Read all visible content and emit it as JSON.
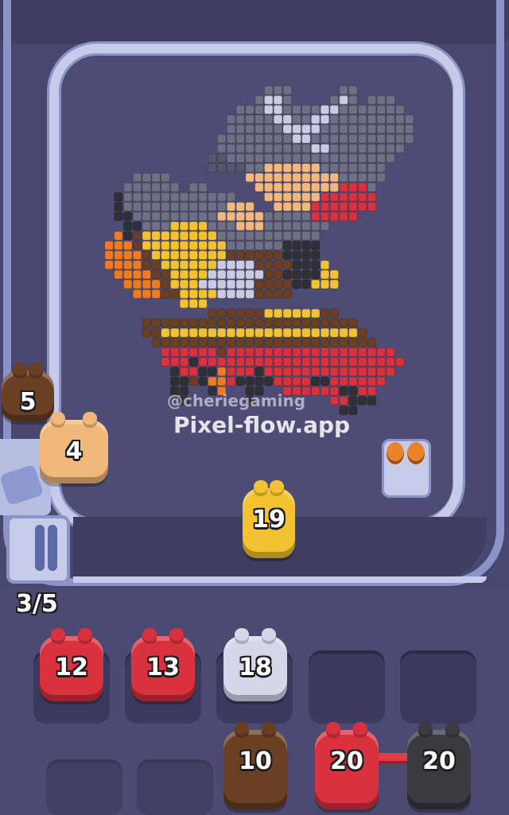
{
  "watermark": {
    "handle": "@cheriegaming",
    "site": "Pixel-flow.app"
  },
  "queue_counter": "3/5",
  "colors": {
    "red": "#d9313e",
    "yellow": "#f2c230",
    "white": "#d4d7ea",
    "brown": "#6a3f24",
    "tan": "#f0b87a",
    "black": "#3a3a3f",
    "gray": "#6b6f84",
    "orange": "#f07a1e"
  },
  "track_shooters": [
    {
      "number": "5",
      "color": "brown"
    },
    {
      "number": "4",
      "color": "tan"
    },
    {
      "number": "19",
      "color": "yellow"
    }
  ],
  "slots_row1": [
    {
      "number": "12",
      "color": "red"
    },
    {
      "number": "13",
      "color": "red"
    },
    {
      "number": "18",
      "color": "white"
    },
    {
      "number": "",
      "color": ""
    },
    {
      "number": "",
      "color": ""
    }
  ],
  "slots_row2": [
    {
      "number": "10",
      "color": "brown"
    },
    {
      "number": "20",
      "color": "red"
    },
    {
      "number": "20",
      "color": "black"
    }
  ],
  "bin_icon": "coin-icon"
}
